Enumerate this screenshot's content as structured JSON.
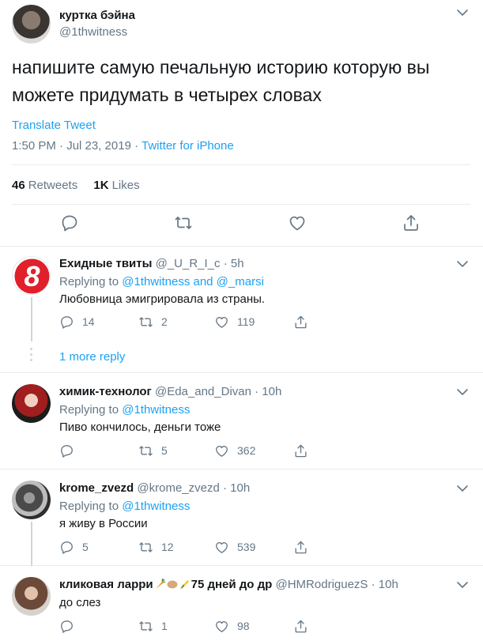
{
  "tweet": {
    "author_name": "куртка бэйна",
    "author_handle": "@1thwitness",
    "text": "напишите самую печальную историю которую вы можете придумать в четырех словах",
    "translate_label": "Translate Tweet",
    "timestamp": "1:50 PM · Jul 23, 2019 · ",
    "source": "Twitter for iPhone",
    "retweets_count": "46",
    "retweets_label": "Retweets",
    "likes_count": "1K",
    "likes_label": "Likes"
  },
  "icons": {
    "reply": "reply-icon",
    "retweet": "retweet-icon",
    "like": "heart-icon",
    "share": "share-icon",
    "menu": "chevron-down-icon"
  },
  "colors": {
    "accent": "#1da1f2",
    "secondary": "#657786",
    "border": "#e6ecf0"
  },
  "replies": [
    {
      "name": "Ехидные твиты",
      "handle": "@_U_R_I_c · 5h",
      "replying_prefix": "Replying to ",
      "replying_to": "@1thwitness and @_marsi",
      "text": "Любовница эмигрировала из страны.",
      "replies": "14",
      "retweets": "2",
      "likes": "119",
      "more_replies": "1 more reply"
    },
    {
      "name": "химик-технолог",
      "handle": "@Eda_and_Divan · 10h",
      "replying_prefix": "Replying to ",
      "replying_to": "@1thwitness",
      "text": "Пиво кончилось, деньги тоже",
      "replies": "",
      "retweets": "5",
      "likes": "362"
    },
    {
      "name": "krome_zvezd",
      "handle": "@krome_zvezd · 10h",
      "replying_prefix": "Replying to ",
      "replying_to": "@1thwitness",
      "text": "я живу в России",
      "replies": "5",
      "retweets": "12",
      "likes": "539"
    },
    {
      "name_prefix": "кликовая ларри",
      "name_suffix": "75 дней до др",
      "handle": "@HMRodriguezS · 10h",
      "text": "до слез",
      "replies": "",
      "retweets": "1",
      "likes": "98"
    }
  ]
}
